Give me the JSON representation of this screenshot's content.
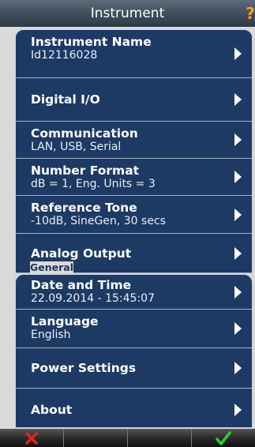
{
  "header": {
    "title": "Instrument",
    "help_mark": "?"
  },
  "menu_top": [
    {
      "title": "Instrument Name",
      "sub": "Id12116028"
    },
    {
      "title": "Digital I/O"
    },
    {
      "title": "Communication",
      "sub": "LAN, USB, Serial"
    },
    {
      "title": "Number Format",
      "sub": "dB = 1, Eng. Units = 3"
    },
    {
      "title": "Reference Tone",
      "sub": "-10dB, SineGen, 30 secs"
    },
    {
      "title": "Analog Output"
    }
  ],
  "section": {
    "general": "General"
  },
  "menu_general": [
    {
      "title": "Date and Time",
      "sub": "22.09.2014 - 15:45:07"
    },
    {
      "title": "Language",
      "sub": "English"
    },
    {
      "title": "Power Settings"
    },
    {
      "title": "About"
    }
  ],
  "toolbar": {
    "cancel_icon": "cross-icon",
    "confirm_icon": "checkmark-icon",
    "cancel_color": "#e02020",
    "confirm_color": "#2ecc2e"
  }
}
